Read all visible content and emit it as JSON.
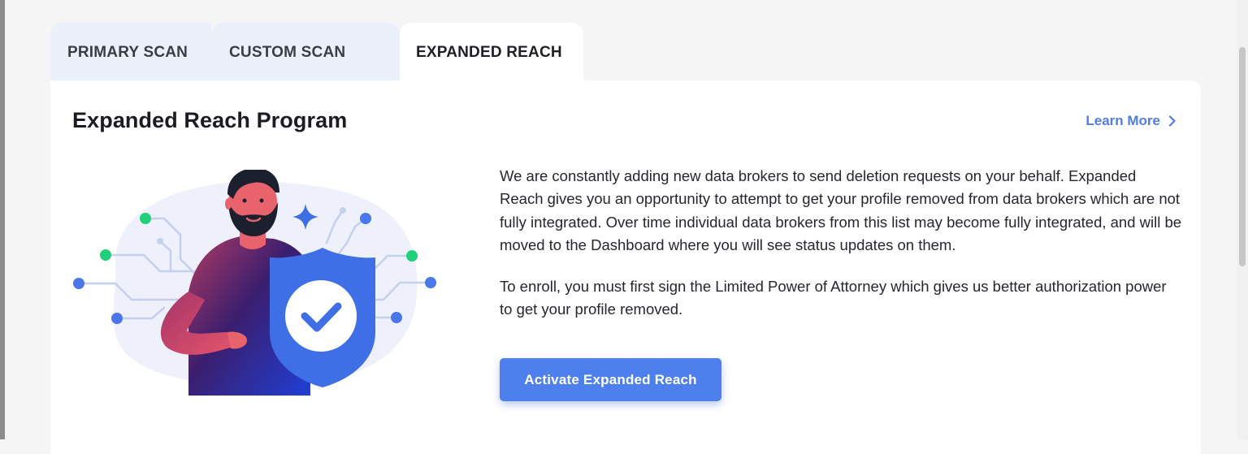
{
  "tabs": [
    {
      "label": "PRIMARY SCAN"
    },
    {
      "label": "CUSTOM SCAN"
    },
    {
      "label": "EXPANDED REACH",
      "active": true
    }
  ],
  "card": {
    "title": "Expanded Reach Program",
    "learn_more": "Learn More",
    "paragraphs": [
      "We are constantly adding new data brokers to send deletion requests on your behalf. Expanded Reach gives you an opportunity to attempt to get your profile removed from data brokers which are not fully integrated. Over time individual data brokers from this list may become fully integrated, and will be moved to the Dashboard where you will see status updates on them.",
      "To enroll, you must first sign the Limited Power of Attorney which gives us better authorization power to get your profile removed."
    ],
    "activate_button": "Activate Expanded Reach",
    "illustration": {
      "icons": [
        "person-illustration",
        "shield-check-icon",
        "sparkle-icon",
        "circuit-lines"
      ]
    }
  },
  "colors": {
    "accent": "#4d80ec",
    "link": "#4f7de6",
    "tab_inactive_bg": "#ebf0fb",
    "card_bg": "#ffffff",
    "page_bg": "#f5f5f5",
    "node_green": "#22d07a",
    "node_blue": "#4a78ea"
  }
}
